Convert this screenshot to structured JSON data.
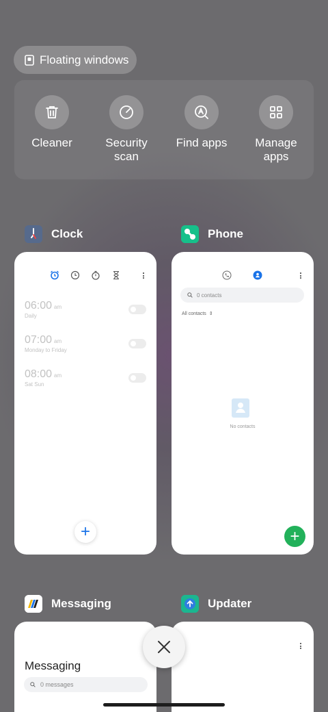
{
  "floating_windows": {
    "label": "Floating windows",
    "icon": "floating-window-icon"
  },
  "quick_actions": [
    {
      "label": "Cleaner",
      "icon": "trash-icon"
    },
    {
      "label": "Security\nscan",
      "icon": "gauge-icon"
    },
    {
      "label": "Find apps",
      "icon": "find-apps-icon"
    },
    {
      "label": "Manage\napps",
      "icon": "grid-icon"
    }
  ],
  "apps": {
    "clock": {
      "title": "Clock",
      "alarms": [
        {
          "time": "06:00",
          "ampm": "am",
          "repeat": "Daily"
        },
        {
          "time": "07:00",
          "ampm": "am",
          "repeat": "Monday to Friday"
        },
        {
          "time": "08:00",
          "ampm": "am",
          "repeat": "Sat Sun"
        }
      ],
      "add_label": "+"
    },
    "phone": {
      "title": "Phone",
      "search_placeholder": "0 contacts",
      "filter_label": "All contacts",
      "empty_text": "No contacts",
      "add_label": "+"
    },
    "messaging": {
      "title": "Messaging",
      "heading": "Messaging",
      "search_placeholder": "0 messages"
    },
    "updater": {
      "title": "Updater"
    }
  },
  "close_all": {
    "icon": "close-icon"
  },
  "colors": {
    "accent_blue": "#1a73e8",
    "accent_green": "#22b15a"
  }
}
